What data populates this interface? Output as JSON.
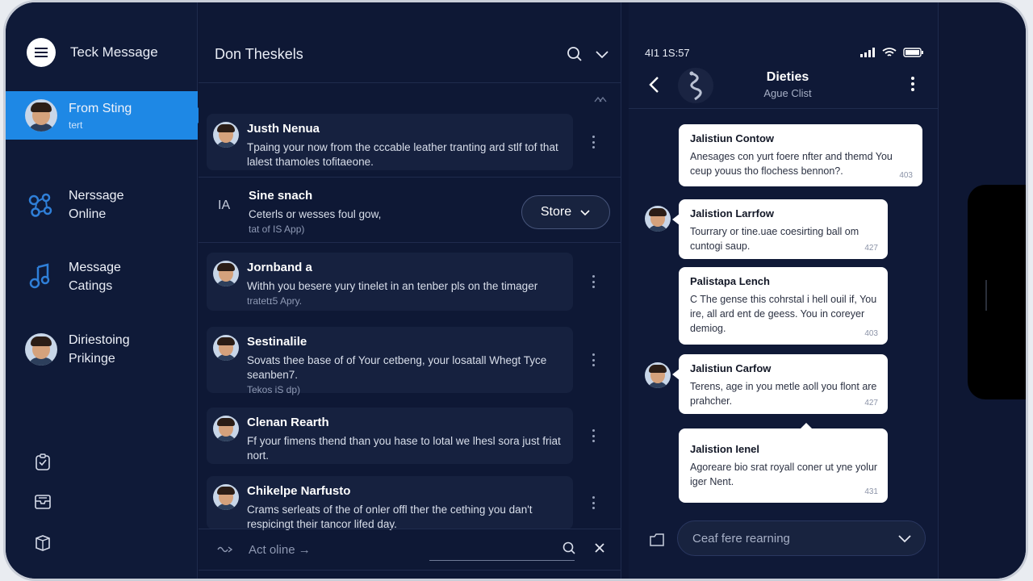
{
  "app": {
    "title": "Teck Message"
  },
  "sidebar": {
    "items": [
      {
        "line1": "From Sting",
        "line2": "tert"
      },
      {
        "line1": "Nerssage",
        "line2": "Online"
      },
      {
        "line1": "Message",
        "line2": "Catings"
      },
      {
        "line1": "Diriestoing",
        "line2": "Prikinge"
      }
    ],
    "bottom_icons": [
      "checklist-icon",
      "inbox-icon",
      "box-icon"
    ]
  },
  "list": {
    "title": "Don Theskels",
    "messages": [
      {
        "name": "Justh Nenua",
        "body": "Tpaing your now from the cccable leather tranting ard stlf tof that lalest thamoles tofitaeone.",
        "time": ""
      },
      {
        "name": "Jornband a",
        "body": "Withh you besere yury tinelet in an tenber pls on the timager",
        "time": "tratetɪ5 Apry."
      },
      {
        "name": "Sestinalile",
        "body": "Sovats thee base of of Your cetbeng, your losatall Whegt Tyce seanben7.",
        "time": "Tekos iS dp)"
      },
      {
        "name": "Clenan Rearth",
        "body": "Ff your fimens thend than you hase to lotal we lhesl sora just friat nort.",
        "time": ""
      },
      {
        "name": "Chikelpe Narfusto",
        "body": "Crams serleats of the of onler offl ther the cething you dan't respicingt their tancor lifed day.",
        "time": ""
      }
    ],
    "plain_row": {
      "prefix": "IA",
      "name": "Sine snach",
      "body": "Ceterls or wesses foul gow,",
      "time": "tat of IS App)",
      "button": "Store"
    },
    "search": {
      "placeholder": "Act oline →"
    }
  },
  "chat": {
    "status_time": "4I1 1S:57",
    "title": "Dieties",
    "subtitle": "Ague Clist",
    "bubbles": [
      {
        "name": "Jalistiun Contow",
        "text": "Anesages con yurt foere nfter and themd You ceup youus tho flochess bennon?.",
        "time": "403"
      },
      {
        "name": "Jalistion Larrfow",
        "text": "Tourrary or tine.uae coesirting ball om cuntogi saup.",
        "time": "427"
      },
      {
        "name": "Palistapa Lench",
        "text": "C The gense this cohrstal i hell ouil if, You ire, all ard ent de geess. You in coreyer demiog.",
        "time": "403"
      },
      {
        "name": "Jalistiun Carfow",
        "text": "Terens, age in you metle aoll you flont are prahcher.",
        "time": "427"
      },
      {
        "name": "Jalistion Ienel",
        "text": "Agoreare bio srat royall coner ut yne yolur iger Nent.",
        "time": "431"
      }
    ],
    "composer": {
      "placeholder": "Ceaf fere rearning"
    }
  },
  "colors": {
    "accent": "#1e88e5",
    "background": "#0d1633",
    "bubble": "#ffffff"
  }
}
